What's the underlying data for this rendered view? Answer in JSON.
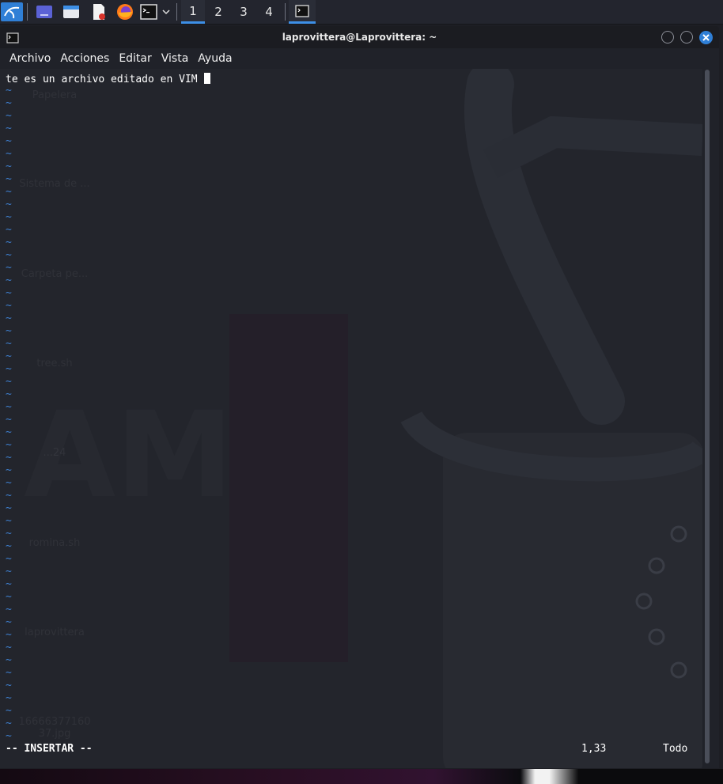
{
  "taskbar": {
    "workspaces": [
      "1",
      "2",
      "3",
      "4"
    ],
    "active_workspace": "1"
  },
  "window": {
    "title": "laprovittera@Laprovittera: ~"
  },
  "menu": [
    "Archivo",
    "Acciones",
    "Editar",
    "Vista",
    "Ayuda"
  ],
  "editor": {
    "first_line": "te es un archivo editado en VIM ",
    "tilde_char": "~",
    "tilde_count": 52,
    "mode": "-- INSERTAR --",
    "position": "1,33",
    "scroll": "Todo"
  },
  "desktop_icons": [
    "Papelera",
    "Sistema de ...",
    "Carpeta pe...",
    "tree.sh",
    "...24",
    "romina.sh",
    "laprovittera",
    "16666377160\n37.jpg"
  ],
  "colors": {
    "accent": "#3d8fe6",
    "tilde": "#3e7fcf",
    "close_button": "#2f7fd6"
  }
}
